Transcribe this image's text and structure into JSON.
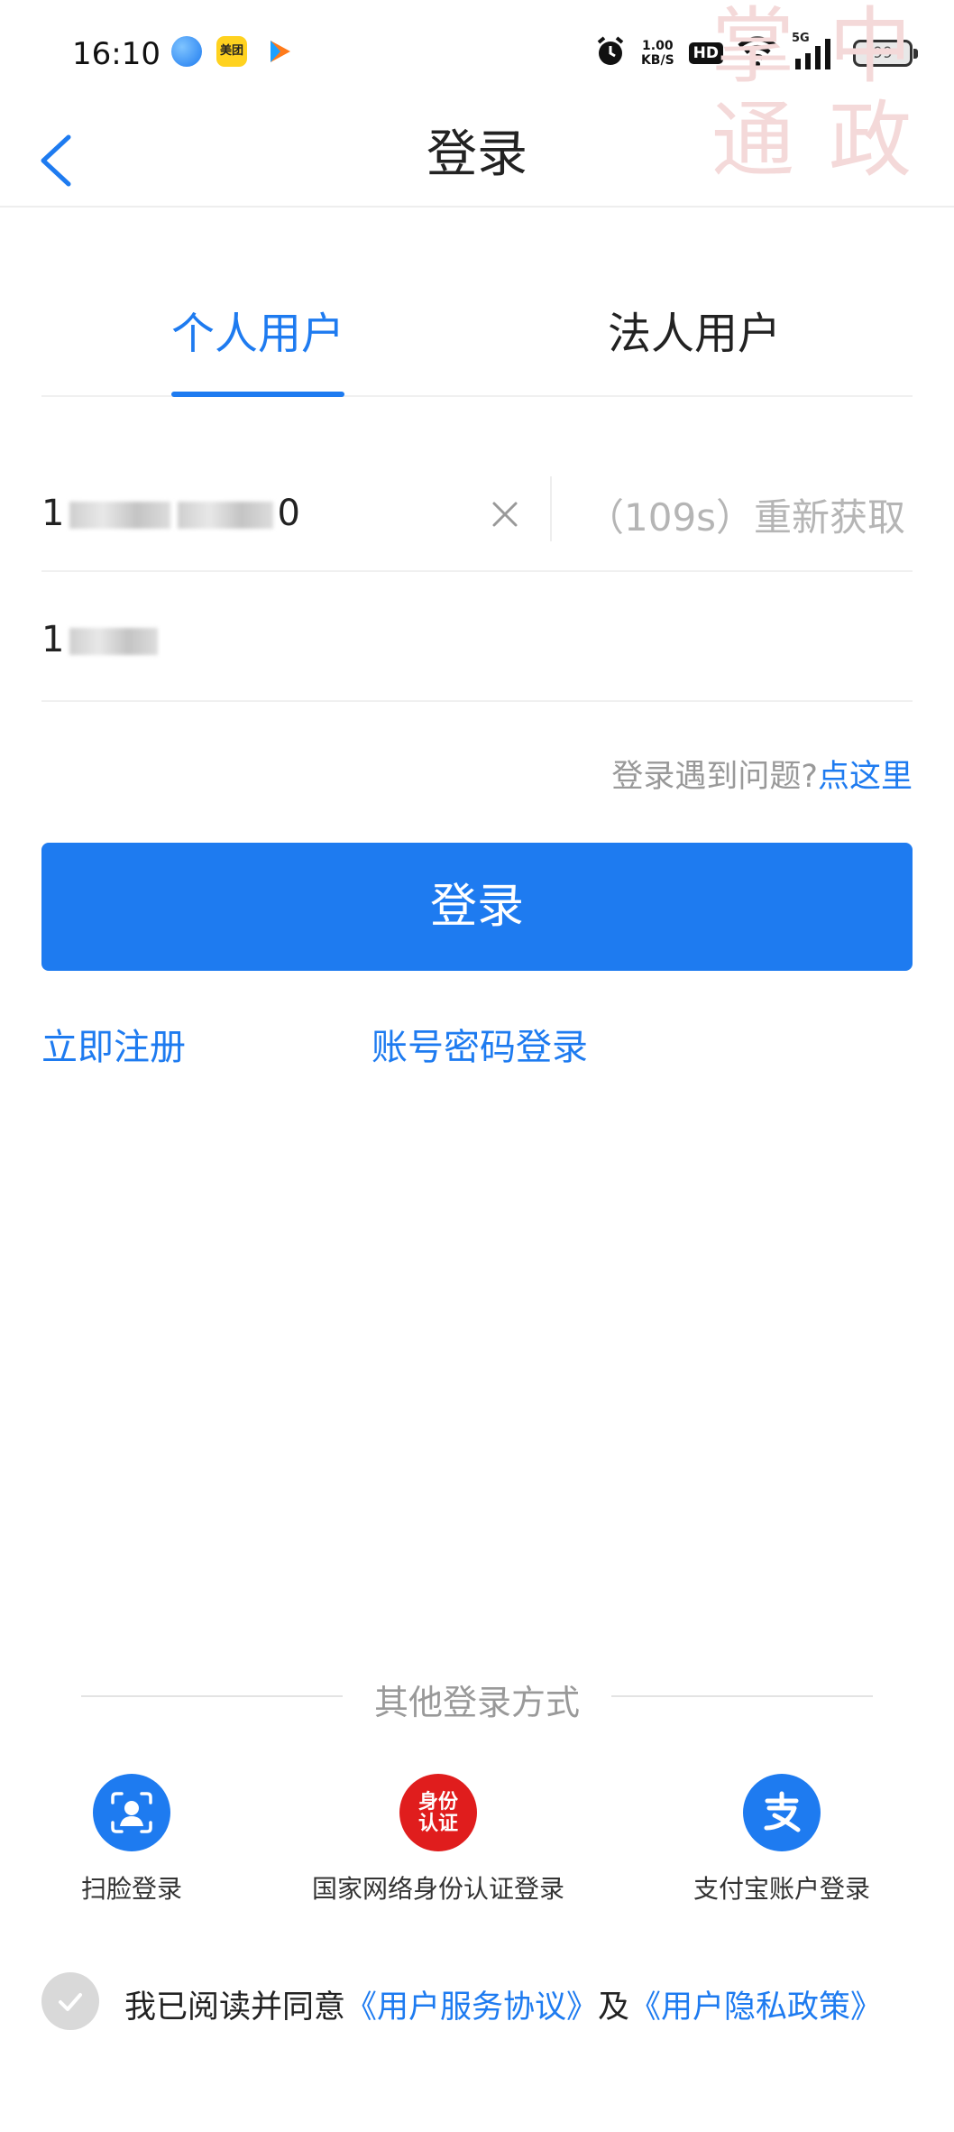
{
  "status_bar": {
    "time": "16:10",
    "meituan_label": "美团",
    "net_speed_value": "1.00",
    "net_speed_unit": "KB/S",
    "hd_label": "HD",
    "network_label": "5G",
    "battery": "99"
  },
  "header": {
    "title": "登录"
  },
  "tabs": [
    {
      "label": "个人用户",
      "active": true
    },
    {
      "label": "法人用户",
      "active": false
    }
  ],
  "form": {
    "phone_prefix": "1",
    "phone_suffix": "0",
    "resend_label": "（109s）重新获取",
    "code_prefix": "1"
  },
  "help": {
    "text": "登录遇到问题?",
    "link": "点这里"
  },
  "login_button": "登录",
  "links": {
    "register": "立即注册",
    "password_login": "账号密码登录"
  },
  "other_methods": {
    "title": "其他登录方式",
    "items": [
      {
        "label": "扫脸登录",
        "icon": "face-scan-icon"
      },
      {
        "label": "国家网络身份认证登录",
        "icon": "national-id-icon",
        "icon_text": "身份认证"
      },
      {
        "label": "支付宝账户登录",
        "icon": "alipay-icon"
      }
    ]
  },
  "agreement": {
    "prefix": "我已阅读并同意",
    "service_link": "《用户服务协议》",
    "conjunction": "及",
    "privacy_link": "《用户隐私政策》"
  },
  "colors": {
    "accent": "#1e7bf0",
    "id_badge": "#e01d1d"
  }
}
